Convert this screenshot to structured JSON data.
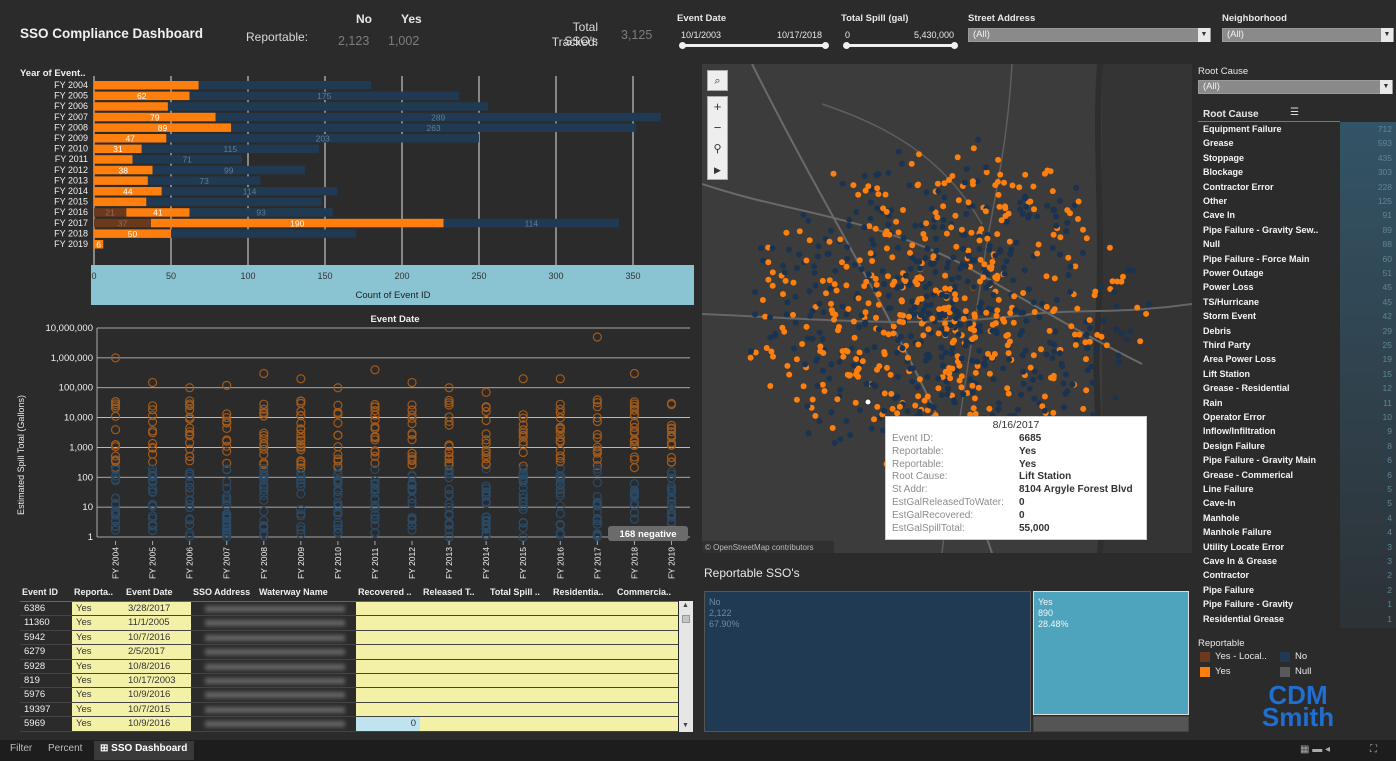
{
  "header": {
    "title": "SSO Compliance Dashboard",
    "reportable_label": "Reportable:",
    "col_no": "No",
    "col_yes": "Yes",
    "val_no": "2,123",
    "val_yes": "1,002",
    "total_label_1": "Total SSO's",
    "total_label_2": "Tracked:",
    "total_value": "3,125"
  },
  "filters": {
    "event_date": {
      "label": "Event Date",
      "from": "10/1/2003",
      "to": "10/17/2018"
    },
    "total_spill": {
      "label": "Total Spill (gal)",
      "from": "0",
      "to": "5,430,000"
    },
    "street_address": {
      "label": "Street Address",
      "value": "(All)"
    },
    "neighborhood": {
      "label": "Neighborhood",
      "value": "(All)"
    },
    "root_cause": {
      "label": "Root Cause",
      "value": "(All)"
    }
  },
  "colors": {
    "orange": "#ff7f0e",
    "navy": "#1f3a52",
    "brown": "#6b3a1c",
    "cyan": "#8ac3d2",
    "teal": "#4ea4bd"
  },
  "chart_data": [
    {
      "type": "bar",
      "title": "Year of Event..",
      "xlabel": "Count of Event ID",
      "xlim": [
        0,
        390
      ],
      "x_ticks": [
        0,
        50,
        100,
        150,
        200,
        250,
        300,
        350
      ],
      "categories": [
        "FY 2004",
        "FY 2005",
        "FY 2006",
        "FY 2007",
        "FY 2008",
        "FY 2009",
        "FY 2010",
        "FY 2011",
        "FY 2012",
        "FY 2013",
        "FY 2014",
        "FY 2015",
        "FY 2016",
        "FY 2017",
        "FY 2018",
        "FY 2019"
      ],
      "series": [
        {
          "name": "Yes - Local..",
          "values": [
            0,
            0,
            0,
            0,
            0,
            0,
            0,
            0,
            0,
            0,
            0,
            0,
            21,
            37,
            0,
            0
          ]
        },
        {
          "name": "Yes",
          "values": [
            68,
            62,
            48,
            79,
            89,
            47,
            31,
            25,
            38,
            35,
            44,
            34,
            41,
            190,
            50,
            6
          ]
        },
        {
          "name": "No",
          "values": [
            112,
            175,
            208,
            289,
            263,
            203,
            115,
            71,
            99,
            73,
            114,
            114,
            93,
            114,
            120,
            0
          ]
        }
      ],
      "labels": {
        "yes": [
          "",
          "62",
          "",
          "79",
          "89",
          "47",
          "31",
          "",
          "38",
          "",
          "44",
          "",
          "41",
          "190",
          "50",
          "6"
        ],
        "no": [
          "",
          "175",
          "",
          "289",
          "263",
          "203",
          "115",
          "71",
          "99",
          "73",
          "114",
          "",
          "93",
          "114",
          "",
          ""
        ],
        "local": [
          "",
          "",
          "",
          "",
          "",
          "",
          "",
          "",
          "",
          "",
          "",
          "",
          "21",
          "37",
          "",
          ""
        ]
      }
    },
    {
      "type": "scatter",
      "title": "Event Date",
      "ylabel": "Estimated Spill Total (Gallons)",
      "y_scale": "log",
      "y_ticks": [
        "1",
        "10",
        "100",
        "1,000",
        "10,000",
        "100,000",
        "1,000,000",
        "10,000,000"
      ],
      "categories": [
        "FY 2004",
        "FY 2005",
        "FY 2006",
        "FY 2007",
        "FY 2008",
        "FY 2009",
        "FY 2010",
        "FY 2011",
        "FY 2012",
        "FY 2013",
        "FY 2014",
        "FY 2015",
        "FY 2016",
        "FY 2017",
        "FY 2018",
        "FY 2019"
      ],
      "max_points": [
        1000000,
        150000,
        100000,
        120000,
        300000,
        200000,
        100000,
        400000,
        150000,
        100000,
        70000,
        200000,
        200000,
        5000000,
        300000,
        30000
      ],
      "badge": "168 negative"
    },
    {
      "type": "table",
      "title": "Reportable SSO's",
      "cells": [
        {
          "label": "No",
          "count": "2,122",
          "pct": "67.90%"
        },
        {
          "label": "Yes",
          "count": "890",
          "pct": "28.48%"
        }
      ]
    }
  ],
  "table": {
    "headers": [
      "Event ID",
      "Reporta..",
      "Event Date",
      "SSO Address",
      "Waterway Name",
      "Recovered ..",
      "Released T..",
      "Total Spill ..",
      "Residentia..",
      "Commercia.."
    ],
    "rows": [
      {
        "id": "6386",
        "rep": "Yes",
        "date": "3/28/2017"
      },
      {
        "id": "11360",
        "rep": "Yes",
        "date": "11/1/2005"
      },
      {
        "id": "5942",
        "rep": "Yes",
        "date": "10/7/2016"
      },
      {
        "id": "6279",
        "rep": "Yes",
        "date": "2/5/2017"
      },
      {
        "id": "5928",
        "rep": "Yes",
        "date": "10/8/2016"
      },
      {
        "id": "819",
        "rep": "Yes",
        "date": "10/17/2003"
      },
      {
        "id": "5976",
        "rep": "Yes",
        "date": "10/9/2016"
      },
      {
        "id": "19397",
        "rep": "Yes",
        "date": "10/7/2015"
      },
      {
        "id": "5969",
        "rep": "Yes",
        "date": "10/9/2016",
        "recovered": "0"
      }
    ]
  },
  "map": {
    "attribution": "© OpenStreetMap contributors",
    "tooltip": {
      "date": "8/16/2017",
      "rows": [
        {
          "k": "Event ID:",
          "v": "6685"
        },
        {
          "k": "Reportable:",
          "v": "Yes"
        },
        {
          "k": "Reportable:",
          "v": "Yes"
        },
        {
          "k": "Root Cause:",
          "v": "Lift Station"
        },
        {
          "k": "St Addr:",
          "v": "8104 Argyle Forest Blvd"
        },
        {
          "k": "EstGalReleasedToWater:",
          "v": "0"
        },
        {
          "k": "EstGalRecovered:",
          "v": "0"
        },
        {
          "k": "EstGalSpillTotal:",
          "v": "55,000"
        }
      ]
    }
  },
  "root_cause": {
    "header": "Root Cause",
    "items": [
      {
        "name": "Equipment Failure",
        "val": "712"
      },
      {
        "name": "Grease",
        "val": "593"
      },
      {
        "name": "Stoppage",
        "val": "435"
      },
      {
        "name": "Blockage",
        "val": "303"
      },
      {
        "name": "Contractor Error",
        "val": "228"
      },
      {
        "name": "Other",
        "val": "125"
      },
      {
        "name": "Cave In",
        "val": "91"
      },
      {
        "name": "Pipe Failure - Gravity Sew..",
        "val": "89"
      },
      {
        "name": "Null",
        "val": "88"
      },
      {
        "name": "Pipe Failure - Force Main",
        "val": "60"
      },
      {
        "name": "Power Outage",
        "val": "51"
      },
      {
        "name": "Power Loss",
        "val": "45"
      },
      {
        "name": "TS/Hurricane",
        "val": "45"
      },
      {
        "name": "Storm Event",
        "val": "42"
      },
      {
        "name": "Debris",
        "val": "29"
      },
      {
        "name": "Third Party",
        "val": "25"
      },
      {
        "name": "Area Power Loss",
        "val": "19"
      },
      {
        "name": "Lift Station",
        "val": "15"
      },
      {
        "name": "Grease - Residential",
        "val": "12"
      },
      {
        "name": "Rain",
        "val": "11"
      },
      {
        "name": "Operator Error",
        "val": "10"
      },
      {
        "name": "Inflow/Infiltration",
        "val": "9"
      },
      {
        "name": "Design Failure",
        "val": "8"
      },
      {
        "name": "Pipe Failure - Gravity Main",
        "val": "6"
      },
      {
        "name": "Grease - Commerical",
        "val": "6"
      },
      {
        "name": "Line Failure",
        "val": "5"
      },
      {
        "name": "Cave-In",
        "val": "5"
      },
      {
        "name": "Manhole",
        "val": "4"
      },
      {
        "name": "Manhole Failure",
        "val": "4"
      },
      {
        "name": "Utility Locate Error",
        "val": "3"
      },
      {
        "name": "Cave In & Grease",
        "val": "3"
      },
      {
        "name": "Contractor",
        "val": "2"
      },
      {
        "name": "Pipe Failure",
        "val": "2"
      },
      {
        "name": "Pipe Failure - Gravity",
        "val": "1"
      },
      {
        "name": "Residential Grease",
        "val": "1"
      }
    ]
  },
  "legend": {
    "title": "Reportable",
    "items": [
      {
        "label": "Yes - Local..",
        "color": "#6b3a1c"
      },
      {
        "label": "No",
        "color": "#1f3a52"
      },
      {
        "label": "Yes",
        "color": "#ff7f0e"
      },
      {
        "label": "Null",
        "color": "#5a5a5a"
      }
    ]
  },
  "logo": {
    "line1": "CDM",
    "line2": "Smith"
  },
  "tabs": [
    "Filter",
    "Percent",
    "SSO Dashboard"
  ]
}
